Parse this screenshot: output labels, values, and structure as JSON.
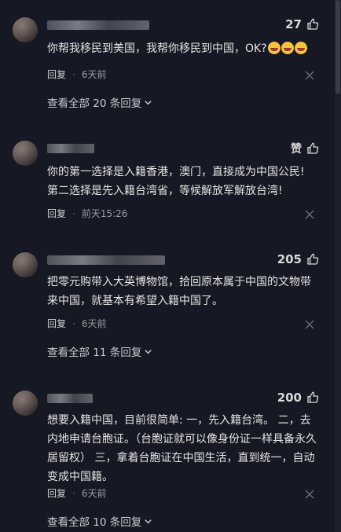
{
  "comments": [
    {
      "likes": "27",
      "text": "你帮我移民到美国，我帮你移民到中国，OK?",
      "reply_label": "回复",
      "time": "6天前",
      "view_replies": "查看全部 20 条回复"
    },
    {
      "likes": "赞",
      "text": "你的第一选择是入籍香港，澳门，直接成为中国公民! 第二选择是先入籍台湾省，等候解放军解放台湾!",
      "reply_label": "回复",
      "time": "前天15:26",
      "view_replies": ""
    },
    {
      "likes": "205",
      "text": "把零元购带入大英博物馆，拾回原本属于中国的文物带来中国，就基本有希望入籍中国了。",
      "reply_label": "回复",
      "time": "6天前",
      "view_replies": "查看全部 11 条回复"
    },
    {
      "likes": "200",
      "text": "想要入籍中国，目前很简单: 一，先入籍台湾。 二，去内地申请台胞证。（台胞证就可以像身份证一样具备永久居留权） 三，拿着台胞证在中国生活，直到统一，自动变成中国籍。",
      "reply_label": "回复",
      "time": "6天前",
      "view_replies": "查看全部 10 条回复"
    }
  ],
  "icons": {
    "like": "thumbs-up-icon",
    "close": "close-icon",
    "expand": "chevron-down-icon",
    "emoji": "laughing-emoji-icon"
  },
  "colors": {
    "background": "#161823",
    "text": "#e6e6e6",
    "muted": "#9a9ba3"
  }
}
